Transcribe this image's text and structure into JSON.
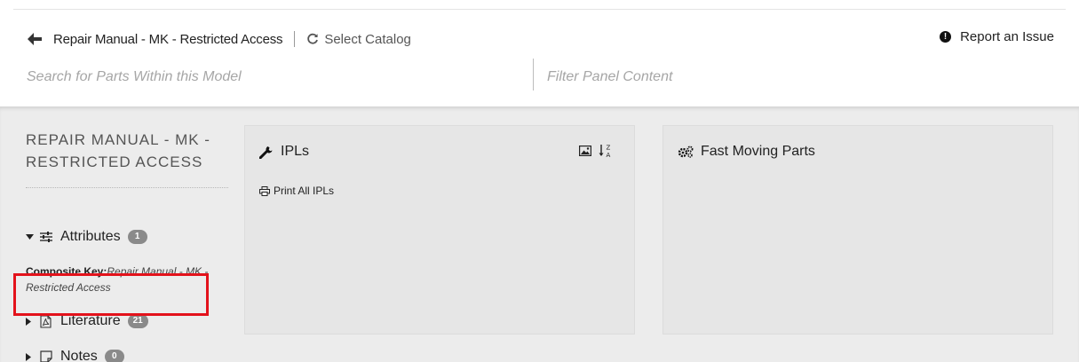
{
  "header": {
    "back_icon": "arrow-left-icon",
    "title": "Repair Manual - MK - Restricted Access",
    "select_catalog_label": "Select Catalog",
    "select_catalog_icon": "refresh-icon",
    "report_label": "Report an Issue",
    "report_icon": "exclamation-circle-icon"
  },
  "search": {
    "parts_placeholder": "Search for Parts Within this Model",
    "filter_placeholder": "Filter Panel Content"
  },
  "sidebar": {
    "title": "REPAIR MANUAL - MK - RESTRICTED ACCESS",
    "attributes": {
      "label": "Attributes",
      "count": "1",
      "expanded": true,
      "icon": "sliders-icon"
    },
    "composite_key_label": "Composite Key:",
    "composite_key_value": "Repair Manual - MK - Restricted Access",
    "literature": {
      "label": "Literature",
      "count": "21",
      "expanded": false,
      "icon": "pdf-file-icon"
    },
    "notes": {
      "label": "Notes",
      "count": "0",
      "expanded": false,
      "icon": "sticky-note-icon"
    }
  },
  "panels": {
    "ipls": {
      "title": "IPLs",
      "icon": "wrench-icon",
      "print_all_label": "Print All IPLs",
      "tools": [
        "image-icon",
        "sort-alpha-icon"
      ]
    },
    "fast_moving": {
      "title": "Fast Moving Parts",
      "icon": "gears-icon"
    }
  },
  "colors": {
    "highlight": "#e3121b",
    "badge": "#8a8a8a",
    "content_bg": "#ececec",
    "panel_bg": "#e6e6e6"
  }
}
